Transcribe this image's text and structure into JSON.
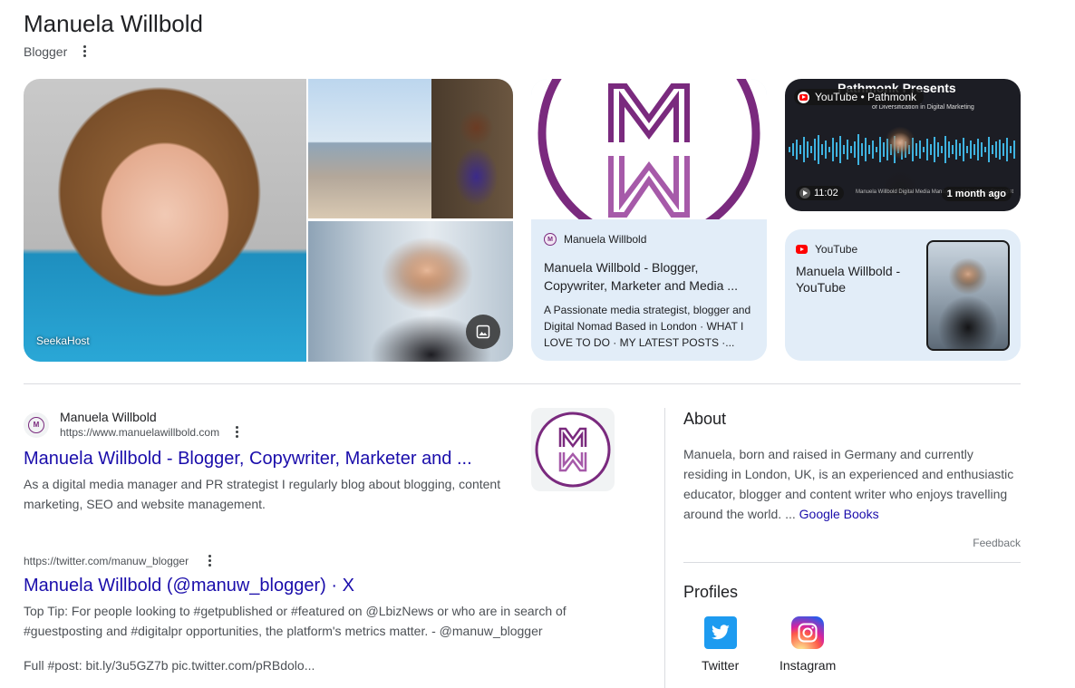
{
  "entity": {
    "name": "Manuela Willbold",
    "subtitle": "Blogger"
  },
  "images": {
    "main_caption": "SeekaHost"
  },
  "site_card": {
    "source": "Manuela Willbold",
    "title": "Manuela Willbold - Blogger, Copywriter, Marketer and Media ...",
    "snippet": "A Passionate media strategist, blogger and Digital Nomad Based in London · WHAT I LOVE TO DO · MY LATEST POSTS ·..."
  },
  "video": {
    "badge": "YouTube • Pathmonk",
    "thumb_title": "Pathmonk Presents",
    "thumb_subtitle": "of Diversification in Digital Marketing",
    "duration": "11:02",
    "age": "1 month ago",
    "caption": "Manuela Willbold Digital Media Manager and Marketing Strategist"
  },
  "yt_card": {
    "source": "YouTube",
    "title": "Manuela Willbold - YouTube"
  },
  "results": [
    {
      "site_name": "Manuela Willbold",
      "url": "https://www.manuelawillbold.com",
      "title": "Manuela Willbold - Blogger, Copywriter, Marketer and ...",
      "snippet": "As a digital media manager and PR strategist I regularly blog about blogging, content marketing, SEO and website management."
    },
    {
      "url": "https://twitter.com/manuw_blogger",
      "title": "Manuela Willbold (@manuw_blogger) · X",
      "snippet": "Top Tip: For people looking to #getpublished or #featured on @LbizNews or who are in search of #guestposting and #digitalpr opportunities, the platform's metrics matter. - @manuw_blogger",
      "snippet2": "Full #post: bit.ly/3u5GZ7b pic.twitter.com/pRBdolo..."
    }
  ],
  "about": {
    "heading": "About",
    "text": "Manuela, born and raised in Germany and currently residing in London, UK, is an experienced and enthusiastic educator, blogger and content writer who enjoys travelling around the world. ... ",
    "link": "Google Books",
    "feedback": "Feedback"
  },
  "profiles": {
    "heading": "Profiles",
    "items": [
      {
        "label": "Twitter",
        "icon": "twitter-icon",
        "color": "#1d9bf0"
      },
      {
        "label": "Instagram",
        "icon": "instagram-icon",
        "color": "#d6249f"
      }
    ]
  },
  "colors": {
    "link": "#1a0dab",
    "card_bg": "#e2edf8",
    "brand_purple": "#7a2a7e"
  }
}
